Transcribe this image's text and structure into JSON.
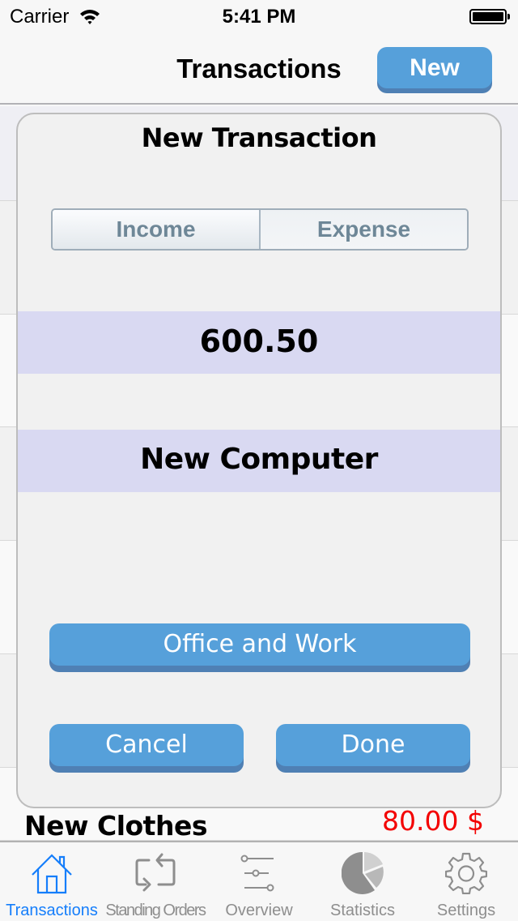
{
  "status_bar": {
    "carrier": "Carrier",
    "time": "5:41 PM",
    "wifi_icon": "wifi-icon",
    "battery_icon": "battery-icon",
    "battery_level": 1.0
  },
  "nav_bar": {
    "title": "Transactions",
    "new_button": "New"
  },
  "background_list": {
    "visible_row": {
      "name": "New Clothes",
      "amount": "80.00 $",
      "amount_color": "#f30000"
    }
  },
  "modal": {
    "title": "New Transaction",
    "segmented": {
      "options": [
        "Income",
        "Expense"
      ],
      "selected": "Expense"
    },
    "amount_value": "600.50",
    "description_value": "New Computer",
    "category_button": "Office and Work",
    "cancel_button": "Cancel",
    "done_button": "Done",
    "field_color": "#d9d9f2",
    "button_color": "#56a0da"
  },
  "tab_bar": {
    "active_color": "#157efb",
    "inactive_color": "#8e8e8e",
    "tabs": [
      {
        "label": "Transactions",
        "icon": "house-icon",
        "active": true
      },
      {
        "label": "Standing Orders",
        "icon": "repeat-icon",
        "active": false
      },
      {
        "label": "Overview",
        "icon": "sliders-icon",
        "active": false
      },
      {
        "label": "Statistics",
        "icon": "pie-chart-icon",
        "active": false
      },
      {
        "label": "Settings",
        "icon": "gear-icon",
        "active": false
      }
    ]
  }
}
